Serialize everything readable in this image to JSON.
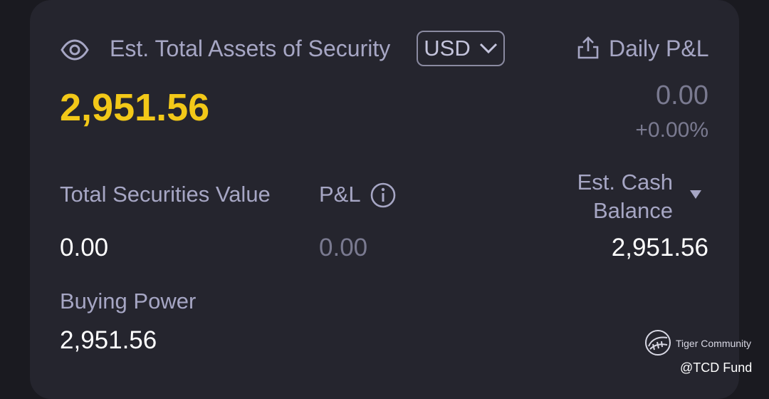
{
  "header": {
    "title": "Est. Total Assets of Security",
    "currency": "USD",
    "daily_pl_label": "Daily P&L",
    "eye_icon": "eye-icon",
    "share_icon": "share-icon"
  },
  "total_assets": {
    "value": "2,951.56",
    "color": "#f2c818"
  },
  "daily_pl": {
    "value": "0.00",
    "percent": "+0.00%"
  },
  "metrics": {
    "securities_label": "Total Securities Value",
    "securities_value": "0.00",
    "pl_label": "P&L",
    "pl_value": "0.00",
    "cash_label_line1": "Est. Cash",
    "cash_label_line2": "Balance",
    "cash_value": "2,951.56",
    "buying_power_label": "Buying Power",
    "buying_power_value": "2,951.56"
  },
  "watermark": {
    "brand": "Tiger Community",
    "handle": "@TCD Fund"
  }
}
